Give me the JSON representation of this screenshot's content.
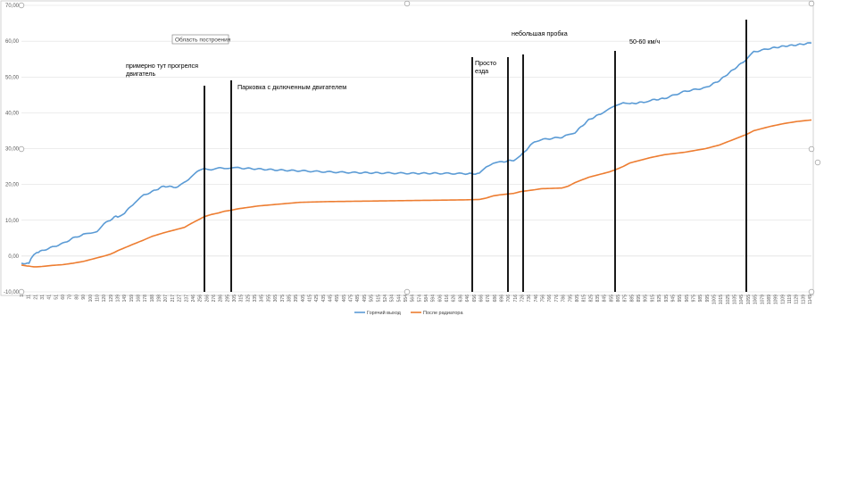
{
  "colors": {
    "series_1": "#5b9bd5",
    "series_2": "#ed7d31",
    "gridline": "#d9d9d9",
    "marker_line": "#000000",
    "handle": "#a6a6a6"
  },
  "icons": [
    "selection-handle-icon"
  ],
  "plot_area_tooltip": "Область построения",
  "chart_data": {
    "type": "line",
    "title": "",
    "xlabel": "",
    "ylabel": "",
    "ylim": [
      -10,
      70
    ],
    "y_ticks": [
      "-10,00",
      "0,00",
      "10,00",
      "20,00",
      "30,00",
      "40,00",
      "50,00",
      "60,00",
      "70,00"
    ],
    "grid": true,
    "legend_position": "bottom",
    "x_tick_labels": [
      "1",
      "11",
      "21",
      "31",
      "41",
      "51",
      "60",
      "70",
      "80",
      "90",
      "100",
      "110",
      "120",
      "129",
      "139",
      "149",
      "159",
      "168",
      "178",
      "188",
      "198",
      "207",
      "217",
      "227",
      "237",
      "246",
      "256",
      "266",
      "276",
      "286",
      "295",
      "305",
      "315",
      "325",
      "335",
      "345",
      "355",
      "365",
      "375",
      "385",
      "395",
      "405",
      "415",
      "425",
      "435",
      "445",
      "455",
      "465",
      "475",
      "485",
      "495",
      "505",
      "515",
      "524",
      "534",
      "544",
      "554",
      "564",
      "574",
      "584",
      "594",
      "606",
      "616",
      "626",
      "636",
      "646",
      "656",
      "666",
      "676",
      "686",
      "696",
      "706",
      "716",
      "726",
      "736",
      "746",
      "756",
      "766",
      "776",
      "786",
      "795",
      "805",
      "815",
      "825",
      "835",
      "845",
      "855",
      "865",
      "875",
      "885",
      "895",
      "905",
      "915",
      "925",
      "935",
      "945",
      "955",
      "965",
      "975",
      "985",
      "995",
      "1005",
      "1015",
      "1025",
      "1035",
      "1045",
      "1055",
      "1065",
      "1079",
      "1089",
      "1099",
      "1109",
      "1119",
      "1129",
      "1139",
      "1149"
    ],
    "x": [
      0,
      9,
      11,
      14,
      18,
      22,
      30,
      45,
      60,
      75,
      90,
      100,
      110,
      120,
      129,
      135,
      140,
      150,
      165,
      178,
      190,
      207,
      227,
      237,
      246,
      256,
      266,
      276,
      286,
      295,
      305,
      315,
      345,
      375,
      405,
      445,
      485,
      524,
      564,
      606,
      646,
      666,
      676,
      686,
      696,
      716,
      726,
      746,
      756,
      786,
      795,
      805,
      825,
      845,
      855,
      865,
      875,
      885,
      905,
      915,
      935,
      965,
      995,
      1015,
      1035,
      1055,
      1065,
      1089,
      1109,
      1129,
      1149
    ],
    "series": [
      {
        "name": "Горячий выход",
        "values": [
          -2,
          -2,
          -2,
          -0.5,
          0.5,
          1,
          1.5,
          2.5,
          3.5,
          5,
          6,
          6.3,
          7,
          9,
          10,
          11,
          11,
          12,
          15,
          17,
          18,
          19.5,
          19.2,
          20.5,
          22,
          23.5,
          24.5,
          24.2,
          24.5,
          24.6,
          24.6,
          24.6,
          24.3,
          24,
          23.8,
          23.5,
          23.3,
          23.2,
          23.1,
          23.1,
          23,
          23,
          25,
          26,
          26.2,
          26.8,
          28,
          32,
          32.5,
          33.2,
          33.8,
          34.5,
          38,
          40,
          41,
          42,
          43,
          42.5,
          43,
          43.5,
          44,
          46,
          47,
          49,
          52,
          55,
          57,
          58,
          58.6,
          59,
          59.5
        ]
      },
      {
        "name": "После радиатора",
        "values": [
          -2.5,
          -2.8,
          -2.8,
          -2.9,
          -3,
          -3,
          -2.9,
          -2.6,
          -2.4,
          -2,
          -1.5,
          -1,
          -0.5,
          0,
          0.5,
          1,
          1.5,
          2.3,
          3.5,
          4.5,
          5.5,
          6.5,
          7.5,
          8,
          9,
          10,
          11,
          11.6,
          12,
          12.5,
          12.8,
          13.2,
          14,
          14.5,
          15,
          15.2,
          15.3,
          15.4,
          15.5,
          15.6,
          15.7,
          15.8,
          16.2,
          16.8,
          17.1,
          17.5,
          18,
          18.5,
          18.8,
          19,
          19.5,
          20.5,
          22,
          23,
          23.5,
          24.2,
          25,
          26,
          27,
          27.5,
          28.3,
          29,
          30,
          31,
          32.5,
          34,
          35,
          36.2,
          37,
          37.6,
          38
        ]
      }
    ],
    "annotations": [
      "примерно тут прогрелся",
      "двигатель",
      "Парковка с дключенным двигателем",
      "Просто",
      "езда",
      "небольшая пробка",
      "50-60 км/ч"
    ]
  }
}
